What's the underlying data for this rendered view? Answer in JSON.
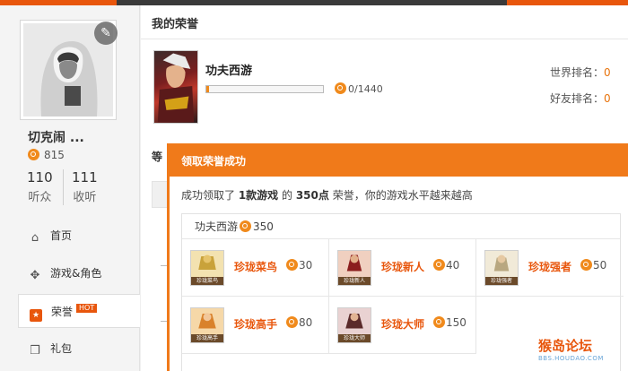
{
  "sidebar": {
    "username": "切克闹 ...",
    "points": "815",
    "stats": [
      {
        "value": "110",
        "label": "听众"
      },
      {
        "value": "111",
        "label": "收听"
      }
    ],
    "nav": [
      {
        "label": "首页",
        "icon": "home-icon"
      },
      {
        "label": "游戏&角色",
        "icon": "gamepad-icon"
      },
      {
        "label": "荣誉",
        "icon": "honor-icon",
        "badge": "HOT"
      },
      {
        "label": "礼包",
        "icon": "gift-icon"
      }
    ]
  },
  "main": {
    "title": "我的荣誉",
    "game": {
      "name": "功夫西游",
      "progress_text": "0/1440",
      "progress_fraction": 0.02
    },
    "ranks": [
      {
        "label": "世界排名：",
        "value": "0"
      },
      {
        "label": "好友排名：",
        "value": "0"
      }
    ],
    "sub_title_fragment": "等"
  },
  "popup": {
    "title": "领取荣誉成功",
    "msg_pre": "成功领取了 ",
    "msg_count": "1款游戏",
    "msg_mid": " 的 ",
    "msg_points": "350点",
    "msg_post": " 荣誉，你的游戏水平越来越高",
    "game_name": "功夫西游",
    "game_points": "350",
    "badges": [
      {
        "name": "珍珑菜鸟",
        "points": "30",
        "tag": "珍珑菜鸟"
      },
      {
        "name": "珍珑新人",
        "points": "40",
        "tag": "珍珑新人"
      },
      {
        "name": "珍珑强者",
        "points": "50",
        "tag": "珍珑强者"
      },
      {
        "name": "珍珑高手",
        "points": "80",
        "tag": "珍珑高手"
      },
      {
        "name": "珍珑大师",
        "points": "150",
        "tag": "珍珑大师"
      }
    ]
  },
  "watermark": {
    "text": "猴岛论坛",
    "url": "BBS.HOUDAO.COM"
  },
  "colors": {
    "accent": "#e8560c",
    "popup": "#f07a1a",
    "coin": "#f08a1c"
  }
}
